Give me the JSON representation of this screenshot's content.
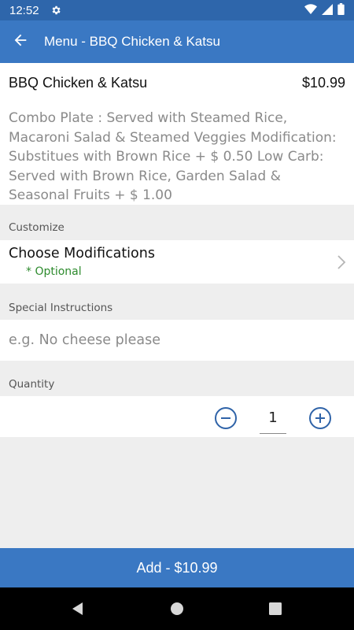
{
  "status_bar": {
    "time": "12:52"
  },
  "app_bar": {
    "title": "Menu - BBQ Chicken & Katsu"
  },
  "item": {
    "name": "BBQ Chicken & Katsu",
    "price": "$10.99",
    "description": "Combo Plate : Served with Steamed Rice, Macaroni Salad & Steamed Veggies Modification: Substitues with Brown Rice + $ 0.50 Low Carb: Served with Brown Rice, Garden Salad & Seasonal Fruits + $ 1.00"
  },
  "customize": {
    "section_label": "Customize",
    "title": "Choose Modifications",
    "optional_label": "* Optional"
  },
  "special_instructions": {
    "section_label": "Special Instructions",
    "placeholder": "e.g. No cheese please"
  },
  "quantity": {
    "section_label": "Quantity",
    "value": "1"
  },
  "add_button": {
    "label": "Add - $10.99"
  },
  "colors": {
    "status_bar": "#2e66ab",
    "app_bar": "#3a78c3",
    "optional_text": "#2e8b2e",
    "stepper_icon": "#2f63a8"
  },
  "icons": [
    "settings-gear-icon",
    "wifi-icon",
    "signal-icon",
    "battery-icon",
    "back-arrow-icon",
    "chevron-right-icon",
    "minus-circle-icon",
    "plus-circle-icon",
    "nav-back-icon",
    "nav-home-icon",
    "nav-recents-icon"
  ]
}
